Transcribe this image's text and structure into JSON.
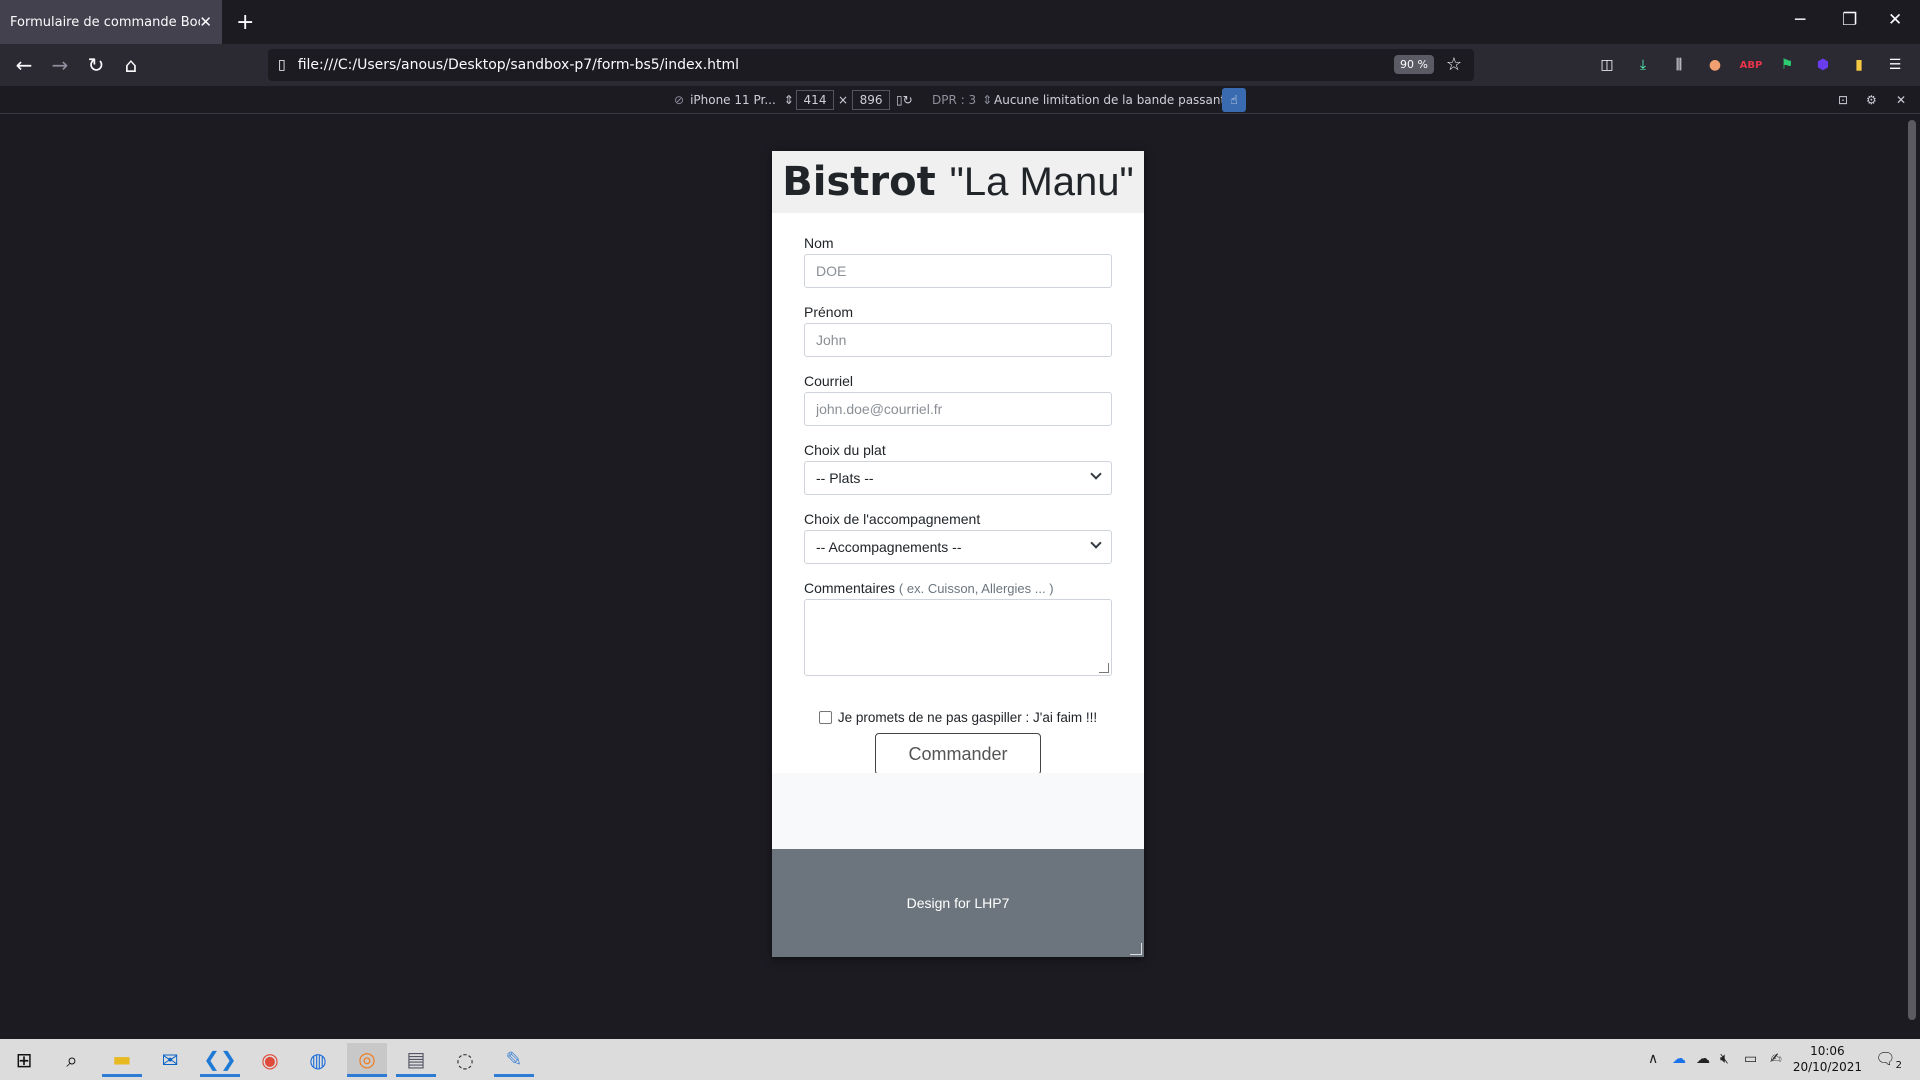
{
  "browser": {
    "tab_title": "Formulaire de commande BootStrap",
    "url": "file:///C:/Users/anous/Desktop/sandbox-p7/form-bs5/index.html",
    "zoom": "90 %"
  },
  "rdm": {
    "device": "iPhone 11 Pr...",
    "width": "414",
    "times": "×",
    "height": "896",
    "dpr": "DPR : 3",
    "throttling": "Aucune limitation de la bande passante"
  },
  "page": {
    "title_bold": "Bistrot",
    "title_light": "\"La Manu\"",
    "fields": {
      "nom_label": "Nom",
      "nom_placeholder": "DOE",
      "prenom_label": "Prénom",
      "prenom_placeholder": "John",
      "courriel_label": "Courriel",
      "courriel_placeholder": "john.doe@courriel.fr",
      "plat_label": "Choix du plat",
      "plat_value": "-- Plats --",
      "accomp_label": "Choix de l'accompagnement",
      "accomp_value": "-- Accompagnements --",
      "comment_label": "Commentaires",
      "comment_hint": "( ex. Cuisson, Allergies ... )"
    },
    "checkbox_label": "Je promets de ne pas gaspiller : J'ai faim !!!",
    "submit_label": "Commander",
    "footer_text": "Design for LHP7"
  },
  "taskbar": {
    "time": "10:06",
    "date": "20/10/2021",
    "notifications": "2"
  }
}
